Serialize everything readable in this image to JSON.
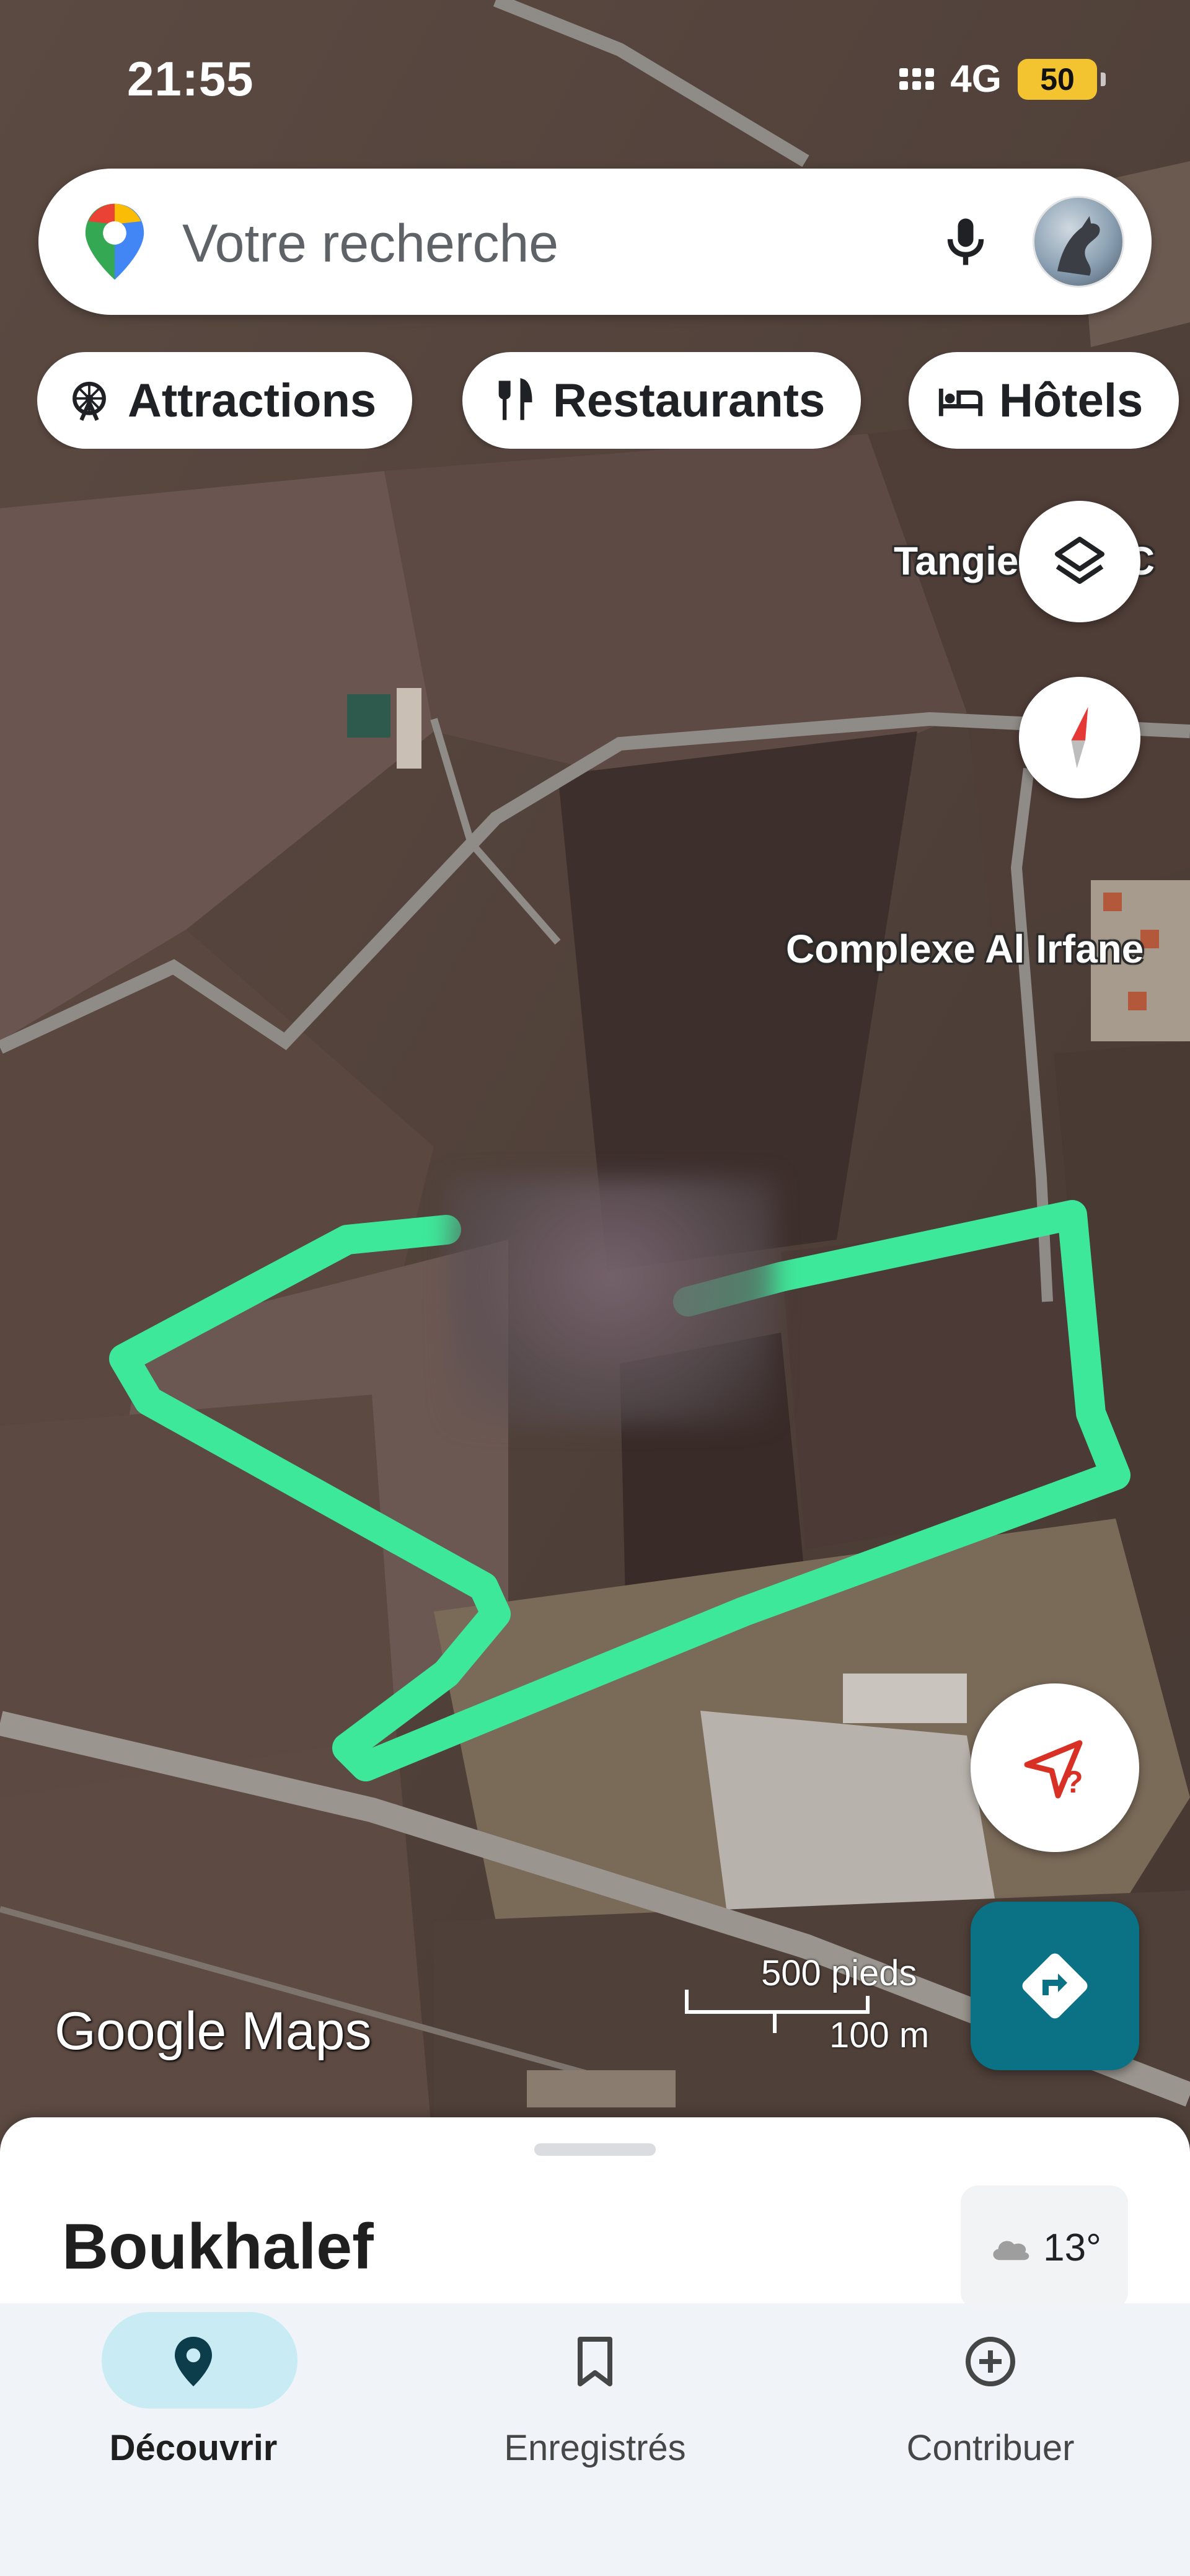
{
  "status_bar": {
    "time": "21:55",
    "network": "4G",
    "battery": "50",
    "battery_color": "#f4c430"
  },
  "search": {
    "placeholder": "Votre recherche",
    "logo_icon": "google-maps-pin-icon",
    "mic_icon": "microphone-icon",
    "avatar": "user-avatar"
  },
  "chips": [
    {
      "label": "Attractions",
      "icon": "ferris-wheel-icon"
    },
    {
      "label": "Restaurants",
      "icon": "fork-knife-icon"
    },
    {
      "label": "Hôtels",
      "icon": "bed-icon"
    }
  ],
  "map": {
    "labels": {
      "tangier": "Tangie",
      "tangier_suffix": "9 C",
      "complexe": "Complexe Al Irfane"
    },
    "watermark": "Google Maps",
    "scale": {
      "feet": "500 pieds",
      "meters": "100 m"
    },
    "route_color": "#3ee89a",
    "layers_icon": "layers-icon",
    "compass_icon": "compass-icon",
    "location_icon": "location-unknown-icon",
    "directions_icon": "directions-icon",
    "directions_color": "#0b7285"
  },
  "sheet": {
    "title": "Boukhalef",
    "weather": {
      "temp": "13°",
      "icon": "cloud-icon"
    }
  },
  "bottom_nav": [
    {
      "label": "Découvrir",
      "icon": "location-pin-icon",
      "active": true
    },
    {
      "label": "Enregistrés",
      "icon": "bookmark-icon",
      "active": false
    },
    {
      "label": "Contribuer",
      "icon": "add-circle-icon",
      "active": false
    }
  ]
}
